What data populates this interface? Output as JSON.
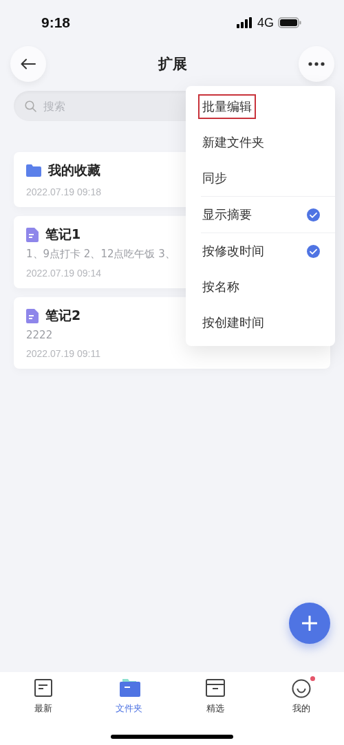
{
  "status_bar": {
    "time": "9:18",
    "network": "4G"
  },
  "header": {
    "title": "扩展"
  },
  "search": {
    "placeholder": "搜索"
  },
  "items": [
    {
      "kind": "folder",
      "title": "我的收藏",
      "date": "2022.07.19 09:18"
    },
    {
      "kind": "note",
      "title": "笔记1",
      "summary": "1、9点打卡 2、12点吃午饭 3、",
      "date": "2022.07.19 09:14"
    },
    {
      "kind": "note",
      "title": "笔记2",
      "summary": "2222",
      "date": "2022.07.19 09:11"
    }
  ],
  "menu": [
    {
      "label": "批量编辑",
      "checked": false,
      "highlighted": true,
      "separator_above": false
    },
    {
      "label": "新建文件夹",
      "checked": false,
      "highlighted": false,
      "separator_above": false
    },
    {
      "label": "同步",
      "checked": false,
      "highlighted": false,
      "separator_above": false
    },
    {
      "label": "显示摘要",
      "checked": true,
      "highlighted": false,
      "separator_above": true
    },
    {
      "label": "按修改时间",
      "checked": true,
      "highlighted": false,
      "separator_above": true
    },
    {
      "label": "按名称",
      "checked": false,
      "highlighted": false,
      "separator_above": false
    },
    {
      "label": "按创建时间",
      "checked": false,
      "highlighted": false,
      "separator_above": false
    }
  ],
  "tabs": [
    {
      "kind": "latest",
      "label": "最新",
      "selected": false,
      "badge": false
    },
    {
      "kind": "folder",
      "label": "文件夹",
      "selected": true,
      "badge": false
    },
    {
      "kind": "box",
      "label": "精选",
      "selected": false,
      "badge": false
    },
    {
      "kind": "face",
      "label": "我的",
      "selected": false,
      "badge": true
    }
  ]
}
